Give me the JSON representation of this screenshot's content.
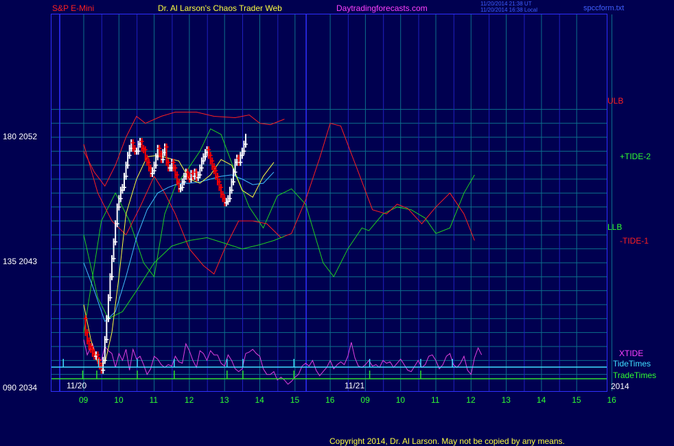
{
  "header": {
    "instrument": "S&P E-Mini",
    "title": "Dr. Al Larson's Chaos Trader Web",
    "site": "Daytradingforecasts.com",
    "timestamp_utc": "11/20/2014 21:38 UT",
    "timestamp_local": "11/20/2014 16:38 Local",
    "file": "spccform.txt"
  },
  "footer": {
    "copyright": "Copyright 2014, Dr. Al Larson. May not be copied by any means."
  },
  "colors": {
    "background": "#000050",
    "grid": "#0c6f8c",
    "frame": "#3030ff",
    "price_up": "#ffffff",
    "price_down": "#ff0000",
    "ulb": "#ff2020",
    "llb": "#20d020",
    "tide2": "#20d020",
    "tide1": "#ff2020",
    "xtide": "#e040e0",
    "tidetimes": "#40e0ff",
    "tradetimes": "#30e030",
    "fast_ma": "#ffff40",
    "slow_ma": "#40c0ff",
    "hour_label": "#30ff30",
    "red_text": "#ff2020",
    "green_text": "#30ff30",
    "magenta_text": "#ff40ff",
    "cyan_text": "#40e0ff"
  },
  "chart_data": {
    "type": "line",
    "y_axis": {
      "ylim": [
        2034,
        2055
      ],
      "labels": [
        {
          "text": "180  2052",
          "value": 2052
        },
        {
          "text": "135  2043",
          "value": 2043
        },
        {
          "text": "090  2034",
          "value": 2034
        }
      ]
    },
    "x_axis": {
      "hour_ticks": [
        "09",
        "10",
        "11",
        "12",
        "13",
        "14",
        "15",
        "16",
        "09",
        "10",
        "11",
        "12",
        "13",
        "14",
        "15",
        "16"
      ],
      "date_labels": [
        "11/20",
        "11/21"
      ],
      "year": "2014"
    },
    "series_labels": [
      {
        "name": "ULB",
        "color": "#ff2020"
      },
      {
        "name": "+TIDE-2",
        "color": "#30ff30"
      },
      {
        "name": "LLB",
        "color": "#30ff30"
      },
      {
        "name": "-TIDE-1",
        "color": "#ff2020"
      },
      {
        "name": "XTIDE",
        "color": "#ff40ff"
      },
      {
        "name": "TideTimes",
        "color": "#40e0ff"
      },
      {
        "name": "TradeTimes",
        "color": "#30ff30"
      }
    ],
    "ulb": [
      [
        0,
        2051
      ],
      [
        0.3,
        2049.5
      ],
      [
        0.6,
        2048.5
      ],
      [
        0.9,
        2050
      ],
      [
        1.2,
        2052
      ],
      [
        1.5,
        2053.5
      ],
      [
        1.75,
        2053
      ],
      [
        2.2,
        2053.5
      ],
      [
        2.6,
        2053.8
      ],
      [
        3.2,
        2053.8
      ],
      [
        3.7,
        2053.5
      ],
      [
        4.3,
        2053.4
      ],
      [
        4.7,
        2053.6
      ],
      [
        5.0,
        2053
      ],
      [
        5.3,
        2052.9
      ],
      [
        5.7,
        2053.3
      ]
    ],
    "llb": [
      [
        0,
        2045
      ],
      [
        0.4,
        2040.5
      ],
      [
        0.7,
        2039
      ],
      [
        1.1,
        2039.5
      ],
      [
        1.5,
        2041
      ],
      [
        2.0,
        2043
      ],
      [
        2.5,
        2044.2
      ],
      [
        3.0,
        2044.6
      ],
      [
        3.5,
        2044.8
      ],
      [
        4.0,
        2044.4
      ],
      [
        4.5,
        2044.0
      ],
      [
        5.0,
        2044.3
      ],
      [
        5.4,
        2044.6
      ],
      [
        5.7,
        2044.9
      ]
    ],
    "tide2": [
      [
        0,
        2038
      ],
      [
        0.5,
        2046
      ],
      [
        0.9,
        2048
      ],
      [
        1.3,
        2046
      ],
      [
        1.7,
        2043
      ],
      [
        2.0,
        2042
      ],
      [
        2.3,
        2046.5
      ],
      [
        2.6,
        2048.5
      ],
      [
        2.9,
        2049.5
      ],
      [
        3.3,
        2051
      ],
      [
        3.6,
        2052.6
      ],
      [
        3.9,
        2052.2
      ],
      [
        4.3,
        2049.5
      ],
      [
        4.7,
        2047
      ],
      [
        5.1,
        2045.5
      ],
      [
        5.5,
        2047.8
      ],
      [
        5.9,
        2048.3
      ],
      [
        6.3,
        2047.2
      ],
      [
        6.8,
        2043
      ],
      [
        7.1,
        2042
      ],
      [
        7.5,
        2044
      ],
      [
        7.9,
        2045.5
      ],
      [
        8.1,
        2045.3
      ],
      [
        8.5,
        2046.5
      ],
      [
        8.9,
        2047
      ],
      [
        9.3,
        2046.8
      ],
      [
        9.7,
        2046.2
      ],
      [
        10.0,
        2045.1
      ],
      [
        10.4,
        2045.5
      ],
      [
        10.8,
        2048
      ],
      [
        11.1,
        2049.3
      ]
    ],
    "tide1": [
      [
        0,
        2051.5
      ],
      [
        0.4,
        2048
      ],
      [
        0.8,
        2046
      ],
      [
        1.2,
        2045
      ],
      [
        1.6,
        2047
      ],
      [
        2.0,
        2049.2
      ],
      [
        2.3,
        2048
      ],
      [
        2.6,
        2046.5
      ],
      [
        3.0,
        2044
      ],
      [
        3.4,
        2042.8
      ],
      [
        3.7,
        2042.2
      ],
      [
        4.0,
        2044
      ],
      [
        4.4,
        2046
      ],
      [
        4.8,
        2046
      ],
      [
        5.2,
        2045.8
      ],
      [
        5.6,
        2044.8
      ],
      [
        5.9,
        2045.1
      ],
      [
        6.3,
        2047.5
      ],
      [
        6.7,
        2050.5
      ],
      [
        7.0,
        2053
      ],
      [
        7.3,
        2052.8
      ],
      [
        7.8,
        2049.5
      ],
      [
        8.2,
        2046.8
      ],
      [
        8.6,
        2046.5
      ],
      [
        8.9,
        2047.2
      ],
      [
        9.2,
        2046.9
      ],
      [
        9.6,
        2045.8
      ],
      [
        10.0,
        2047
      ],
      [
        10.4,
        2048
      ],
      [
        10.8,
        2046.5
      ],
      [
        11.1,
        2044.6
      ]
    ],
    "fast_ma": [
      [
        0,
        2040
      ],
      [
        0.2,
        2037.5
      ],
      [
        0.4,
        2035.8
      ],
      [
        0.6,
        2035.8
      ],
      [
        0.8,
        2038
      ],
      [
        1.0,
        2042
      ],
      [
        1.2,
        2046.5
      ],
      [
        1.5,
        2049
      ],
      [
        1.8,
        2050.6
      ],
      [
        2.1,
        2050.7
      ],
      [
        2.4,
        2050.5
      ],
      [
        2.7,
        2050.3
      ],
      [
        3.0,
        2049
      ],
      [
        3.3,
        2048.7
      ],
      [
        3.6,
        2049.3
      ],
      [
        3.9,
        2050.4
      ],
      [
        4.2,
        2050
      ],
      [
        4.5,
        2048.2
      ],
      [
        4.8,
        2047.7
      ],
      [
        5.1,
        2049.2
      ],
      [
        5.4,
        2050.2
      ]
    ],
    "slow_ma": [
      [
        0,
        2043
      ],
      [
        0.3,
        2041
      ],
      [
        0.6,
        2038.8
      ],
      [
        0.9,
        2039.5
      ],
      [
        1.2,
        2042
      ],
      [
        1.5,
        2044.8
      ],
      [
        1.8,
        2046.8
      ],
      [
        2.1,
        2048
      ],
      [
        2.4,
        2048.4
      ],
      [
        2.7,
        2048.7
      ],
      [
        3.0,
        2048.7
      ],
      [
        3.3,
        2048.8
      ],
      [
        3.6,
        2049
      ],
      [
        3.9,
        2049.2
      ],
      [
        4.2,
        2049.3
      ],
      [
        4.5,
        2049
      ],
      [
        4.8,
        2048.6
      ],
      [
        5.1,
        2048.7
      ],
      [
        5.4,
        2049.5
      ]
    ],
    "price_path": [
      [
        0,
        2039
      ],
      [
        0.05,
        2038
      ],
      [
        0.1,
        2037.4
      ],
      [
        0.15,
        2037
      ],
      [
        0.2,
        2036.8
      ],
      [
        0.25,
        2036.5
      ],
      [
        0.3,
        2036.3
      ],
      [
        0.35,
        2036.4
      ],
      [
        0.4,
        2036
      ],
      [
        0.45,
        2035.6
      ],
      [
        0.5,
        2035.3
      ],
      [
        0.55,
        2036
      ],
      [
        0.6,
        2037.5
      ],
      [
        0.65,
        2039
      ],
      [
        0.7,
        2040.5
      ],
      [
        0.75,
        2042
      ],
      [
        0.8,
        2043.3
      ],
      [
        0.85,
        2044.5
      ],
      [
        0.9,
        2045.8
      ],
      [
        0.95,
        2047
      ],
      [
        1.0,
        2047.6
      ],
      [
        1.05,
        2048.2
      ],
      [
        1.1,
        2048.4
      ],
      [
        1.15,
        2049.2
      ],
      [
        1.2,
        2050
      ],
      [
        1.25,
        2050.7
      ],
      [
        1.3,
        2051.2
      ],
      [
        1.35,
        2051.6
      ],
      [
        1.4,
        2051.2
      ],
      [
        1.45,
        2051
      ],
      [
        1.5,
        2051
      ],
      [
        1.55,
        2051.5
      ],
      [
        1.6,
        2051.7
      ],
      [
        1.65,
        2051.2
      ],
      [
        1.7,
        2051.1
      ],
      [
        1.75,
        2050.5
      ],
      [
        1.8,
        2050.2
      ],
      [
        1.85,
        2049.8
      ],
      [
        1.9,
        2049.4
      ],
      [
        1.95,
        2049.6
      ],
      [
        2.0,
        2050
      ],
      [
        2.05,
        2050.6
      ],
      [
        2.1,
        2051.2
      ],
      [
        2.15,
        2050.8
      ],
      [
        2.2,
        2050.4
      ],
      [
        2.25,
        2050.9
      ],
      [
        2.3,
        2051.3
      ],
      [
        2.35,
        2050.2
      ],
      [
        2.4,
        2049.8
      ],
      [
        2.45,
        2049.8
      ],
      [
        2.5,
        2050.2
      ],
      [
        2.55,
        2049.8
      ],
      [
        2.6,
        2049.3
      ],
      [
        2.65,
        2048.8
      ],
      [
        2.7,
        2048.3
      ],
      [
        2.75,
        2048.4
      ],
      [
        2.8,
        2048.8
      ],
      [
        2.85,
        2049.2
      ],
      [
        2.9,
        2049.5
      ],
      [
        2.95,
        2049.2
      ],
      [
        3.0,
        2049
      ],
      [
        3.05,
        2049.4
      ],
      [
        3.1,
        2049.2
      ],
      [
        3.15,
        2049.5
      ],
      [
        3.2,
        2049.1
      ],
      [
        3.25,
        2049.3
      ],
      [
        3.3,
        2049.8
      ],
      [
        3.35,
        2050.3
      ],
      [
        3.4,
        2050.6
      ],
      [
        3.45,
        2050.9
      ],
      [
        3.5,
        2051.1
      ],
      [
        3.55,
        2050.7
      ],
      [
        3.6,
        2050.3
      ],
      [
        3.65,
        2049.9
      ],
      [
        3.7,
        2049.6
      ],
      [
        3.75,
        2049.2
      ],
      [
        3.8,
        2048.8
      ],
      [
        3.85,
        2048.4
      ],
      [
        3.9,
        2047.9
      ],
      [
        3.95,
        2047.6
      ],
      [
        4.0,
        2047.3
      ],
      [
        4.05,
        2047.4
      ],
      [
        4.1,
        2047.6
      ],
      [
        4.15,
        2048.2
      ],
      [
        4.2,
        2048.8
      ],
      [
        4.25,
        2049.5
      ],
      [
        4.3,
        2050.2
      ],
      [
        4.35,
        2050.5
      ],
      [
        4.4,
        2050.2
      ],
      [
        4.45,
        2050.7
      ],
      [
        4.5,
        2051
      ],
      [
        4.55,
        2051.5
      ],
      [
        4.6,
        2052
      ]
    ],
    "xtide": [
      [
        0,
        2037.5
      ],
      [
        0.1,
        2036.4
      ],
      [
        0.25,
        2037.2
      ],
      [
        0.35,
        2036.3
      ],
      [
        0.5,
        2036
      ],
      [
        0.6,
        2037
      ],
      [
        0.7,
        2036.7
      ],
      [
        0.8,
        2036.5
      ],
      [
        0.9,
        2035.5
      ],
      [
        1.0,
        2036.5
      ],
      [
        1.1,
        2036
      ],
      [
        1.2,
        2036.8
      ],
      [
        1.3,
        2035.3
      ],
      [
        1.4,
        2036.8
      ],
      [
        1.5,
        2036.1
      ],
      [
        1.6,
        2036.3
      ],
      [
        1.7,
        2035.7
      ],
      [
        1.8,
        2035
      ],
      [
        1.9,
        2035.4
      ],
      [
        2.0,
        2036.3
      ],
      [
        2.1,
        2036.1
      ],
      [
        2.2,
        2035.7
      ],
      [
        2.3,
        2035.5
      ],
      [
        2.4,
        2035.7
      ],
      [
        2.5,
        2035.6
      ],
      [
        2.6,
        2036.3
      ],
      [
        2.7,
        2035.9
      ],
      [
        2.8,
        2035.8
      ],
      [
        2.9,
        2037.2
      ],
      [
        3.0,
        2036.7
      ],
      [
        3.1,
        2036
      ],
      [
        3.2,
        2035.5
      ],
      [
        3.3,
        2036.7
      ],
      [
        3.4,
        2036.5
      ],
      [
        3.5,
        2036
      ],
      [
        3.6,
        2036.7
      ],
      [
        3.7,
        2036.4
      ],
      [
        3.8,
        2036.4
      ],
      [
        3.9,
        2035.8
      ],
      [
        4.0,
        2035.6
      ],
      [
        4.1,
        2036.4
      ],
      [
        4.2,
        2036
      ],
      [
        4.3,
        2035.4
      ],
      [
        4.4,
        2035.2
      ],
      [
        4.5,
        2035.4
      ],
      [
        4.6,
        2036.5
      ],
      [
        4.7,
        2036.6
      ],
      [
        4.8,
        2036.8
      ],
      [
        4.9,
        2036.5
      ],
      [
        5.0,
        2036.3
      ],
      [
        5.1,
        2035.4
      ],
      [
        5.2,
        2035
      ],
      [
        5.3,
        2035
      ],
      [
        5.4,
        2035.2
      ],
      [
        5.5,
        2034.6
      ],
      [
        5.6,
        2034.8
      ],
      [
        5.7,
        2034.6
      ],
      [
        5.8,
        2034.3
      ],
      [
        5.9,
        2034.5
      ],
      [
        6.0,
        2034.8
      ],
      [
        6.1,
        2035
      ],
      [
        6.2,
        2035.6
      ],
      [
        6.3,
        2035.8
      ],
      [
        6.4,
        2035.6
      ],
      [
        6.5,
        2036
      ],
      [
        6.6,
        2035.3
      ],
      [
        6.7,
        2034.9
      ],
      [
        6.8,
        2035.2
      ],
      [
        6.9,
        2035.5
      ],
      [
        7.0,
        2036
      ],
      [
        7.1,
        2035.4
      ],
      [
        7.2,
        2035.7
      ],
      [
        7.3,
        2035.9
      ],
      [
        7.4,
        2035.7
      ],
      [
        7.5,
        2036.3
      ],
      [
        7.6,
        2037.3
      ],
      [
        7.7,
        2036.2
      ],
      [
        7.8,
        2035.6
      ],
      [
        7.9,
        2035.5
      ],
      [
        8.0,
        2035.7
      ],
      [
        8.1,
        2036
      ],
      [
        8.2,
        2035.6
      ],
      [
        8.3,
        2035.7
      ],
      [
        8.4,
        2035.5
      ],
      [
        8.5,
        2036
      ],
      [
        8.6,
        2035.8
      ],
      [
        8.7,
        2035.9
      ],
      [
        8.8,
        2035.5
      ],
      [
        8.9,
        2035.8
      ],
      [
        9.0,
        2036.1
      ],
      [
        9.1,
        2035.7
      ],
      [
        9.2,
        2035.3
      ],
      [
        9.3,
        2035.2
      ],
      [
        9.4,
        2035.6
      ],
      [
        9.5,
        2036
      ],
      [
        9.6,
        2035.5
      ],
      [
        9.7,
        2035.7
      ],
      [
        9.8,
        2036.3
      ],
      [
        9.9,
        2036.4
      ],
      [
        10.0,
        2036
      ],
      [
        10.1,
        2035.4
      ],
      [
        10.2,
        2035.7
      ],
      [
        10.3,
        2036.3
      ],
      [
        10.4,
        2036.5
      ],
      [
        10.5,
        2035.7
      ],
      [
        10.6,
        2035.5
      ],
      [
        10.7,
        2035.8
      ],
      [
        10.8,
        2036.3
      ],
      [
        10.9,
        2035.3
      ],
      [
        11.0,
        2035
      ],
      [
        11.1,
        2036.2
      ],
      [
        11.2,
        2036.9
      ],
      [
        11.3,
        2036.4
      ]
    ],
    "tide_times_spikes": [
      0.2,
      1.2,
      2.3,
      3.35,
      4.85,
      5.3,
      6.75,
      8.9,
      10.35,
      11.25
    ],
    "trade_times_steps": [
      0.75,
      1.15,
      2.3,
      3.35,
      4.85,
      5.3,
      6.75,
      8.9,
      10.35
    ]
  }
}
